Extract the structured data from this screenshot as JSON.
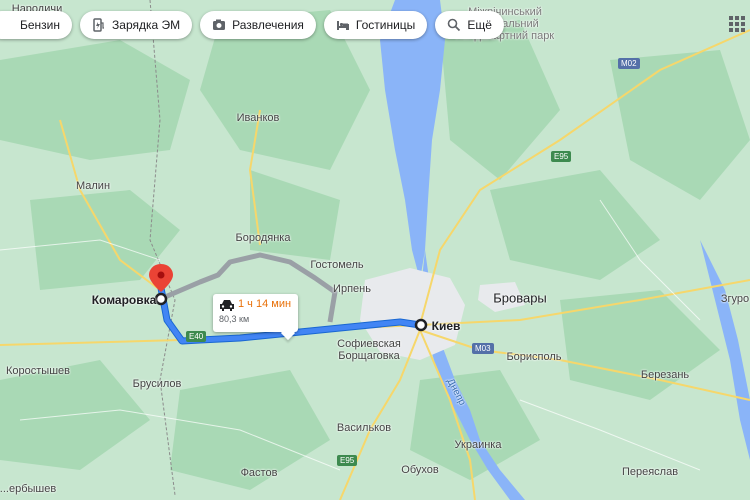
{
  "toolbar": {
    "chips": [
      {
        "label": "Бензин",
        "icon": "fuel-icon"
      },
      {
        "label": "Зарядка ЭМ",
        "icon": "ev-charging-icon"
      },
      {
        "label": "Развлечения",
        "icon": "camera-icon"
      },
      {
        "label": "Гостиницы",
        "icon": "bed-icon"
      },
      {
        "label": "Ещё",
        "icon": "search-icon"
      }
    ],
    "apps_icon": "apps-grid-icon"
  },
  "route": {
    "time": "1 ч 14 мин",
    "distance": "80,3 км",
    "from": "Комаровка",
    "to": "Киев",
    "mode_icon": "car-icon",
    "route_color": "#4285f4",
    "alt_route_color": "#9aa0a6"
  },
  "places": {
    "naroditchi": "Народичи",
    "ivankov": "Иванков",
    "malin": "Малин",
    "borodyanka": "Бородянка",
    "gostomel": "Гостомель",
    "irpen": "Ирпень",
    "komarovka": "Комаровка",
    "kiev": "Киев",
    "brovary": "Бровары",
    "sofievskaya": "Софиевская\nБорщаговка",
    "korostyshev": "Коростышев",
    "brusilov": "Брусилов",
    "borispol": "Борисполь",
    "berezan": "Березань",
    "vasilkov": "Васильков",
    "ukrainka": "Украинка",
    "fastov": "Фастов",
    "obukhov": "Обухов",
    "pereyaslav": "Переяслав",
    "zgurov": "Згуро",
    "berdichev": "...ербышев",
    "park": "Міжрічинський регіональний ландшафтний парк",
    "dnepr": "Днепр"
  },
  "roads": {
    "e40": "E40",
    "e95a": "E95",
    "e95b": "E95",
    "m02": "M02",
    "m03": "M03"
  },
  "colors": {
    "land": "#c7e6cf",
    "forest": "#a5d7b1",
    "water": "#8ab4f8",
    "city": "#e8eaed",
    "road": "#fbe8a5"
  }
}
